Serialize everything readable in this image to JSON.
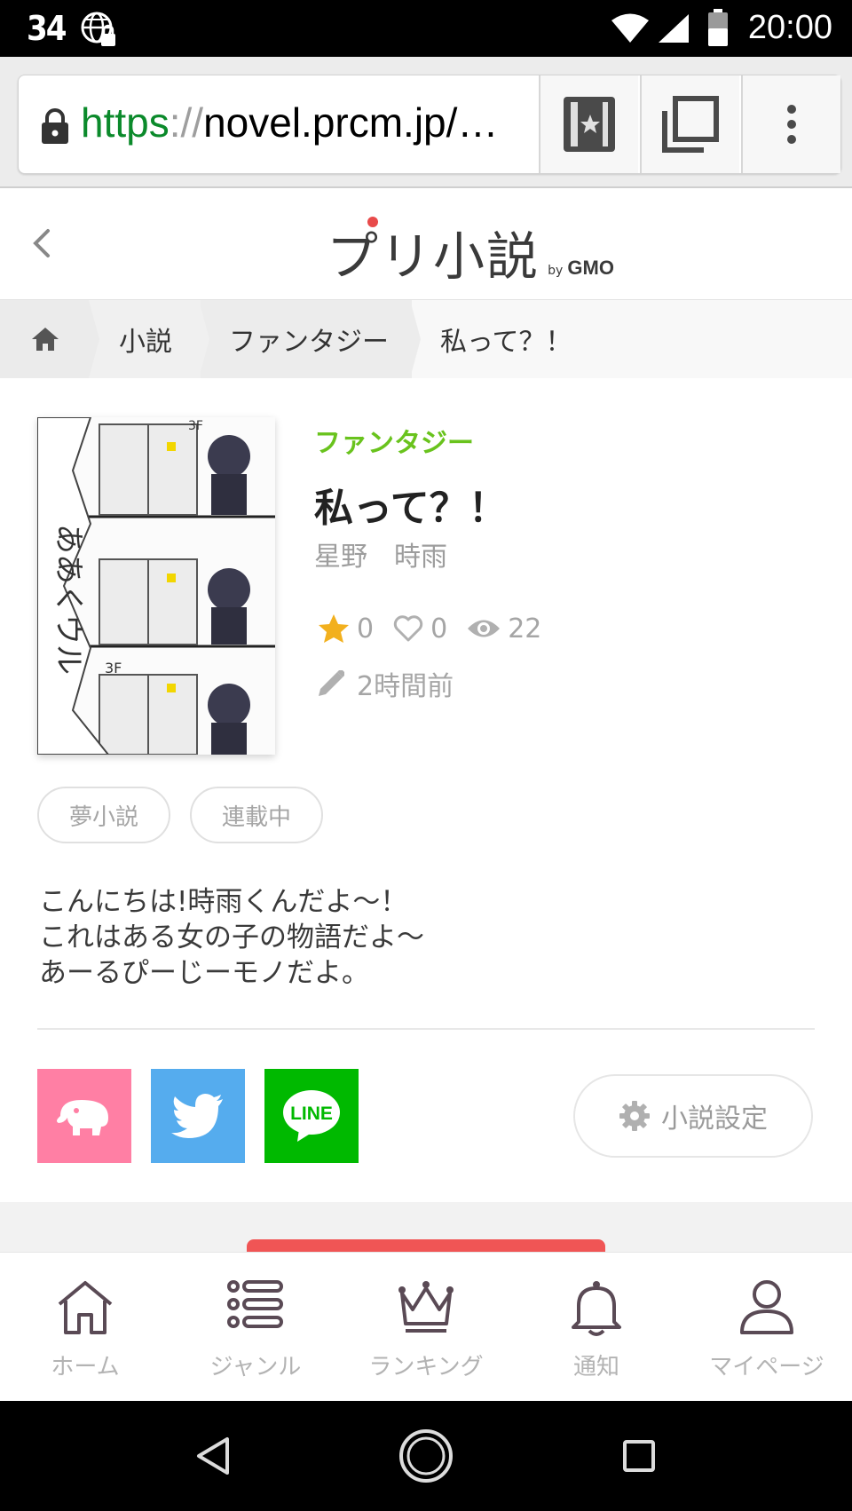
{
  "status_bar": {
    "left_text": "34",
    "time": "20:00"
  },
  "browser": {
    "url_scheme": "https",
    "url_sep": "://",
    "url_rest": "novel.prcm.jp/…"
  },
  "app_header": {
    "logo_text": "プリ小説",
    "logo_by": "by",
    "logo_brand": "GMO"
  },
  "breadcrumb": {
    "items": [
      "小説",
      "ファンタジー",
      "私って？！"
    ]
  },
  "novel": {
    "genre": "ファンタジー",
    "title": "私って？！",
    "author": "星野　時雨",
    "stars": "0",
    "likes": "0",
    "views": "22",
    "updated": "2時間前",
    "tags": [
      "夢小説",
      "連載中"
    ],
    "description": [
      "こんにちは!時雨くんだよ〜！",
      "これはある女の子の物語だよ〜",
      "あーるぴーじーモノだよ。"
    ],
    "settings_label": "小説設定",
    "line_label": "LINE"
  },
  "colors": {
    "genre": "#69c31d",
    "prcm_pink": "#ff7fa4",
    "twitter": "#55acee",
    "line": "#00b900",
    "accent_red": "#f05555"
  },
  "bottom_nav": {
    "home": "ホーム",
    "genre": "ジャンル",
    "ranking": "ランキング",
    "notice": "通知",
    "mypage": "マイページ"
  }
}
